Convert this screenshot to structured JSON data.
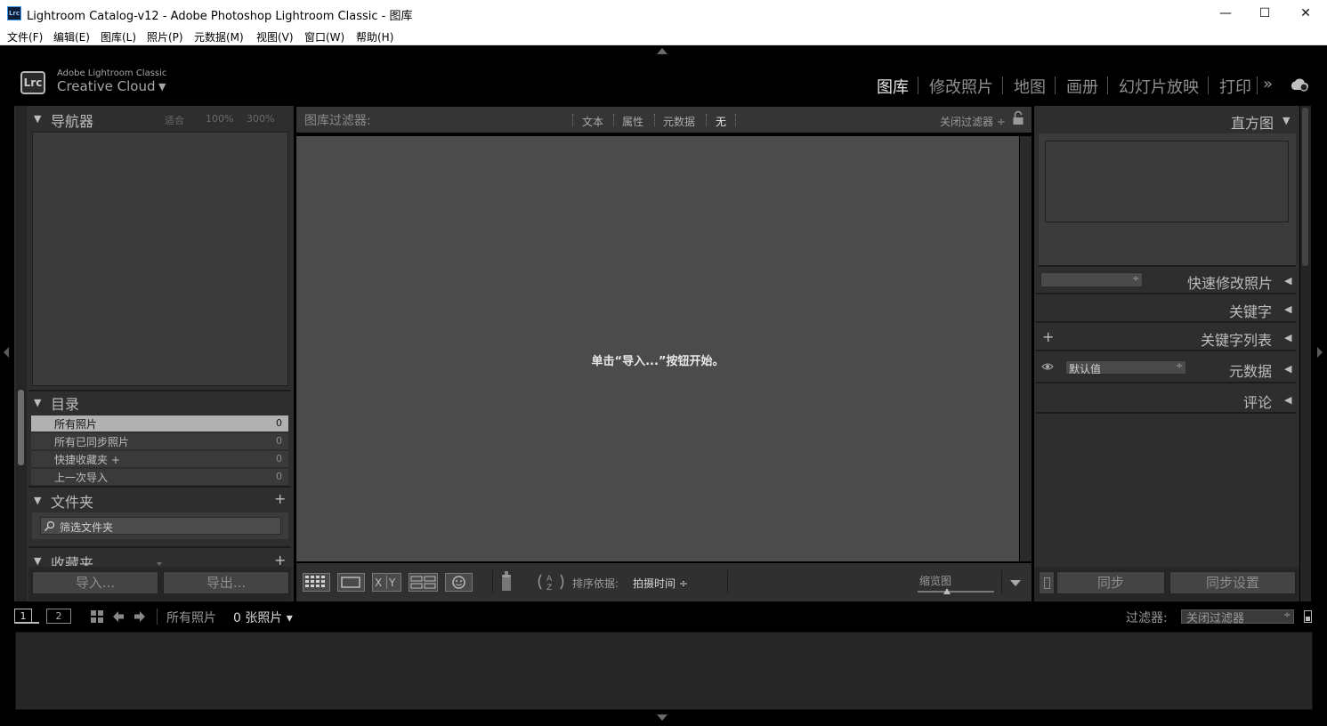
{
  "window": {
    "title": "Lightroom Catalog-v12 - Adobe Photoshop Lightroom Classic - 图库",
    "app_icon": "Lrc",
    "controls": {
      "minimize": "—",
      "maximize": "☐",
      "close": "✕"
    }
  },
  "menu": [
    "文件(F)",
    "编辑(E)",
    "图库(L)",
    "照片(P)",
    "元数据(M)",
    "视图(V)",
    "窗口(W)",
    "帮助(H)"
  ],
  "identity": {
    "logo": "Lrc",
    "adobe": "Adobe Lightroom Classic",
    "product": "Creative Cloud"
  },
  "modules": [
    "图库",
    "修改照片",
    "地图",
    "画册",
    "幻灯片放映",
    "打印"
  ],
  "modules_more": "»",
  "navigator": {
    "title": "导航器",
    "zoom_fit": "适合",
    "zoom_100": "100%",
    "zoom_300": "300%"
  },
  "catalog": {
    "title": "目录",
    "items": [
      {
        "label": "所有照片",
        "count": "0"
      },
      {
        "label": "所有已同步照片",
        "count": "0"
      },
      {
        "label": "快捷收藏夹 +",
        "count": "0"
      },
      {
        "label": "上一次导入",
        "count": "0"
      }
    ]
  },
  "folders": {
    "title": "文件夹",
    "search_placeholder": "筛选文件夹"
  },
  "collections": {
    "title": "收藏夹"
  },
  "left_buttons": {
    "import": "导入...",
    "export": "导出..."
  },
  "filter_bar": {
    "label": "图库过滤器:",
    "tabs": [
      "文本",
      "属性",
      "元数据",
      "无"
    ],
    "preset": "关闭过滤器 ÷"
  },
  "center": {
    "message": "单击“导入...”按钮开始。"
  },
  "toolbar": {
    "sort_label": "排序依据:",
    "sort_value": "拍摄时间 ÷",
    "thumbnail_label": "缩览图"
  },
  "right_panels": {
    "histogram": "直方图",
    "quick_develop": "快速修改照片",
    "keywording": "关键字",
    "keyword_list": "关键字列表",
    "metadata": "元数据",
    "metadata_preset": "默认值",
    "comments": "评论",
    "sync": "同步",
    "sync_settings": "同步设置"
  },
  "filmstrip": {
    "view1": "1",
    "view2": "2",
    "source": "所有照片",
    "count": "0 张照片 ▾",
    "filter_label": "过滤器:",
    "filter_value": "关闭过滤器"
  }
}
